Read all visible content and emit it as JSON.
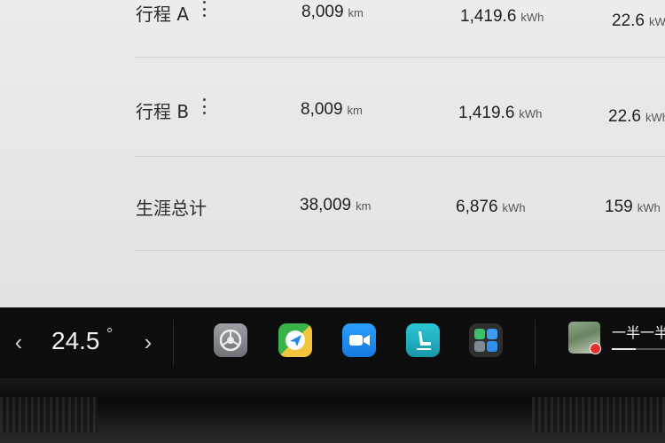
{
  "trips": [
    {
      "label": "行程 A",
      "distance": "8,009",
      "distance_unit": "km",
      "energy": "1,419.6",
      "energy_unit": "kWh",
      "avg": "22.6",
      "avg_unit": "kWh"
    },
    {
      "label": "行程 B",
      "distance": "8,009",
      "distance_unit": "km",
      "energy": "1,419.6",
      "energy_unit": "kWh",
      "avg": "22.6",
      "avg_unit": "kWh"
    },
    {
      "label": "生涯总计",
      "distance": "38,009",
      "distance_unit": "km",
      "energy": "6,876",
      "energy_unit": "kWh",
      "avg": "159",
      "avg_unit": "kWh"
    }
  ],
  "dock": {
    "prev": "‹",
    "next": "›",
    "temperature": "24.5",
    "temperature_unit": "°",
    "apps": [
      {
        "name": "settings",
        "color": "#8c8f94"
      },
      {
        "name": "navigation",
        "color": "#34b24a"
      },
      {
        "name": "video-call",
        "color": "#1a8df0"
      },
      {
        "name": "seat",
        "color": "#22b8c8"
      },
      {
        "name": "app-launcher",
        "color": "#3a3a3a"
      }
    ],
    "media": {
      "title": "一半一半",
      "progress": 0.45
    }
  }
}
